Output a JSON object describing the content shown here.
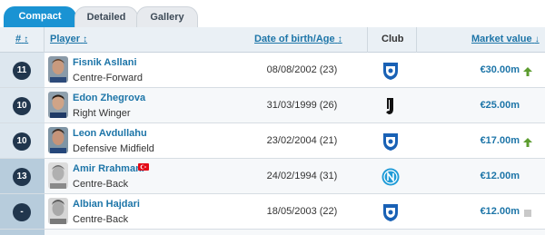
{
  "tabs": [
    {
      "label": "Compact",
      "active": true
    },
    {
      "label": "Detailed",
      "active": false
    },
    {
      "label": "Gallery",
      "active": false
    }
  ],
  "columns": {
    "number": "#",
    "player": "Player",
    "dob": "Date of birth/Age",
    "club": "Club",
    "market_value": "Market value"
  },
  "rows": [
    {
      "number": "11",
      "name": "Fisnik Asllani",
      "position": "Centre-Forward",
      "dob": "08/08/2002 (23)",
      "club_icon": "hoffenheim-crest-icon",
      "market_value": "€30.00m",
      "trend": "up-arrow-icon"
    },
    {
      "number": "10",
      "name": "Edon Zhegrova",
      "position": "Right Winger",
      "dob": "31/03/1999 (26)",
      "club_icon": "juventus-crest-icon",
      "market_value": "€25.00m",
      "trend": ""
    },
    {
      "number": "10",
      "name": "Leon Avdullahu",
      "position": "Defensive Midfield",
      "dob": "23/02/2004 (21)",
      "club_icon": "hoffenheim-crest-icon",
      "market_value": "€17.00m",
      "trend": "up-arrow-icon"
    },
    {
      "number": "13",
      "name": "Amir Rrahmani",
      "position": "Centre-Back",
      "dob": "24/02/1994 (31)",
      "club_icon": "napoli-crest-icon",
      "market_value": "€12.00m",
      "trend": "",
      "flag": "turkey-flag-icon"
    },
    {
      "number": "-",
      "name": "Albian Hajdari",
      "position": "Centre-Back",
      "dob": "18/05/2003 (22)",
      "club_icon": "hoffenheim-crest-icon",
      "market_value": "€12.00m",
      "trend": "unchanged-square-icon"
    }
  ],
  "colors": {
    "accent": "#1a93d3",
    "link": "#1d75a8",
    "number_badge": "#21364d",
    "trend_up": "#5c9c2f"
  }
}
